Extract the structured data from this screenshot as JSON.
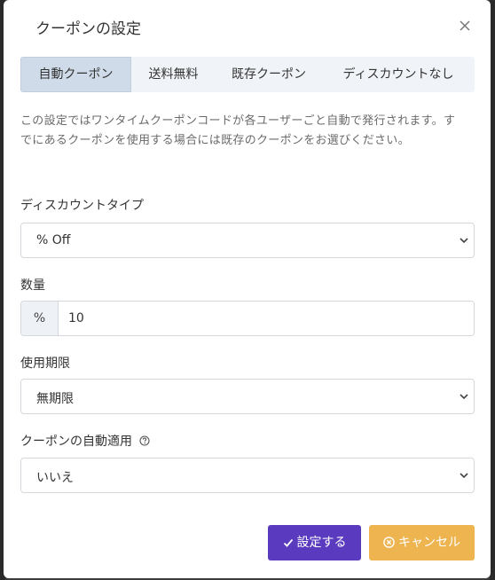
{
  "modal": {
    "title": "クーポンの設定"
  },
  "tabs": [
    {
      "label": "自動クーポン",
      "active": true
    },
    {
      "label": "送料無料",
      "active": false
    },
    {
      "label": "既存クーポン",
      "active": false
    },
    {
      "label": "ディスカウントなし",
      "active": false
    }
  ],
  "description": "この設定ではワンタイムクーポンコードが各ユーザーごと自動で発行されます。すでにあるクーポンを使用する場合には既存のクーポンをお選びください。",
  "discount_type": {
    "label": "ディスカウントタイプ",
    "value": "% Off"
  },
  "amount": {
    "label": "数量",
    "addon": "%",
    "value": "10"
  },
  "expiry": {
    "label": "使用期限",
    "value": "無期限"
  },
  "auto_apply": {
    "label": "クーポンの自動適用",
    "value": "いいえ"
  },
  "buttons": {
    "save": "設定する",
    "cancel": "キャンセル"
  },
  "colors": {
    "primary": "#5a3bbf",
    "cancel": "#edb450",
    "active_tab": "#cfdbe9"
  }
}
